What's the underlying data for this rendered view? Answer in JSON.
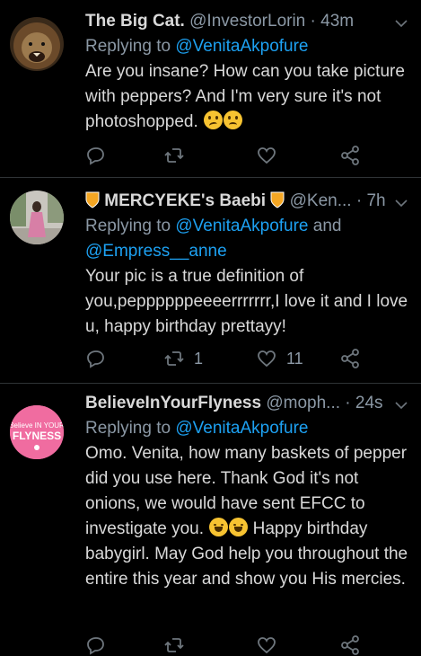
{
  "tweets": [
    {
      "name": "The Big Cat.",
      "handle": "@InvestorLorin",
      "time": "· 43m",
      "replying_prefix": "Replying to ",
      "replying_to": "@VenitaAkpofure",
      "text": "Are you insane? How can you take picture with peppers? And I'm very sure it's not photoshopped.",
      "emoji": [
        "confused-face",
        "frowning-face"
      ],
      "actions": {
        "reply_count": "",
        "retweet_count": "",
        "like_count": ""
      }
    },
    {
      "name": "MERCYEKE's Baebi",
      "handle": "@Ken...",
      "time": "· 7h",
      "replying_prefix": "Replying to ",
      "replying_to": "@VenitaAkpofure",
      "replying_and": " and",
      "replying_to2": "@Empress__anne",
      "text": "Your pic is a true definition of you,peppppppeeeerrrrrrr,I love it and I love u, happy birthday prettayy!",
      "actions": {
        "reply_count": "",
        "retweet_count": "1",
        "like_count": "11"
      }
    },
    {
      "name": "BelieveInYourFlyness",
      "handle": "@moph...",
      "time": "· 24s",
      "replying_prefix": "Replying to ",
      "replying_to": "@VenitaAkpofure",
      "text_a": "Omo. Venita, how many baskets of pepper did you use here. Thank God it's not onions, we would have sent EFCC to investigate you.",
      "text_b": "Happy birthday babygirl. May God help you throughout the entire this year and show you His mercies.",
      "emoji": [
        "tears-of-joy",
        "tears-of-joy"
      ],
      "avatar_text": [
        "Believe IN YOUR",
        "FLYNESS"
      ],
      "actions": {
        "reply_count": "",
        "retweet_count": "",
        "like_count": ""
      }
    }
  ],
  "colors": {
    "background": "#000000",
    "link": "#1DA1F2",
    "muted": "#8B98A5",
    "avatar3": "#F06CA0"
  }
}
